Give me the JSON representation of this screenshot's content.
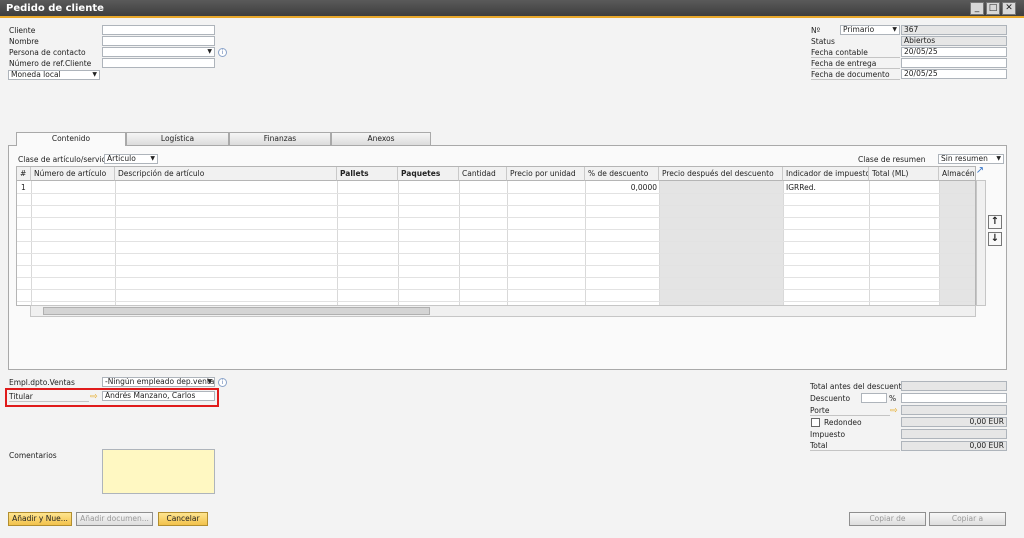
{
  "window": {
    "title": "Pedido de cliente",
    "controls": [
      "_",
      "□",
      "✕"
    ]
  },
  "header_left": {
    "cliente": {
      "label": "Cliente",
      "value": ""
    },
    "nombre": {
      "label": "Nombre",
      "value": ""
    },
    "persona_contacto": {
      "label": "Persona de contacto",
      "value": ""
    },
    "num_ref_cliente": {
      "label": "Número de ref.Cliente",
      "value": ""
    },
    "moneda": {
      "label": "Moneda local"
    }
  },
  "header_right": {
    "numero": {
      "label": "Nº",
      "series": "Primario",
      "value": "367"
    },
    "status": {
      "label": "Status",
      "value": "Abiertos"
    },
    "fecha_contable": {
      "label": "Fecha contable",
      "value": "20/05/25"
    },
    "fecha_entrega": {
      "label": "Fecha de entrega",
      "value": ""
    },
    "fecha_documento": {
      "label": "Fecha de documento",
      "value": "20/05/25"
    }
  },
  "tabs": [
    {
      "label": "Contenido",
      "active": true
    },
    {
      "label": "Logística",
      "active": false
    },
    {
      "label": "Finanzas",
      "active": false
    },
    {
      "label": "Anexos",
      "active": false
    }
  ],
  "content": {
    "clase_articulo_label": "Clase de artículo/servicio",
    "clase_articulo_value": "Artículo",
    "clase_resumen_label": "Clase de resumen",
    "clase_resumen_value": "Sin resumen",
    "columns": [
      "#",
      "Número de artículo",
      "Descripción de artículo",
      "Pallets",
      "Paquetes",
      "Cantidad",
      "Precio por unidad",
      "% de descuento",
      "Precio después del descuento",
      "Indicador de impuestos",
      "Total (ML)",
      "Almacén"
    ],
    "rows": [
      {
        "num": "1",
        "descuento": "0,0000",
        "impuesto": "IGRRed."
      }
    ],
    "move_up": "↑",
    "move_down": "↓"
  },
  "footer_left": {
    "empleado": {
      "label": "Empl.dpto.Ventas",
      "value": "-Ningún empleado dep.venta"
    },
    "titular": {
      "label": "Titular",
      "value": "Andrés Manzano, Carlos"
    },
    "comentarios": {
      "label": "Comentarios",
      "value": ""
    }
  },
  "footer_right": {
    "total_antes": {
      "label": "Total antes del descuento",
      "value": ""
    },
    "descuento": {
      "label": "Descuento",
      "percent_sign": "%",
      "value": ""
    },
    "porte": {
      "label": "Porte",
      "value": ""
    },
    "redondeo": {
      "label": "Redondeo",
      "value": "0,00 EUR",
      "checked": false
    },
    "impuesto": {
      "label": "Impuesto",
      "value": ""
    },
    "total": {
      "label": "Total",
      "value": "0,00 EUR"
    }
  },
  "buttons": {
    "add_new": "Añadir y Nue...",
    "add_doc": "Añadir documen...",
    "cancel": "Cancelar",
    "copy_from": "Copiar de",
    "copy_to": "Copiar a"
  }
}
